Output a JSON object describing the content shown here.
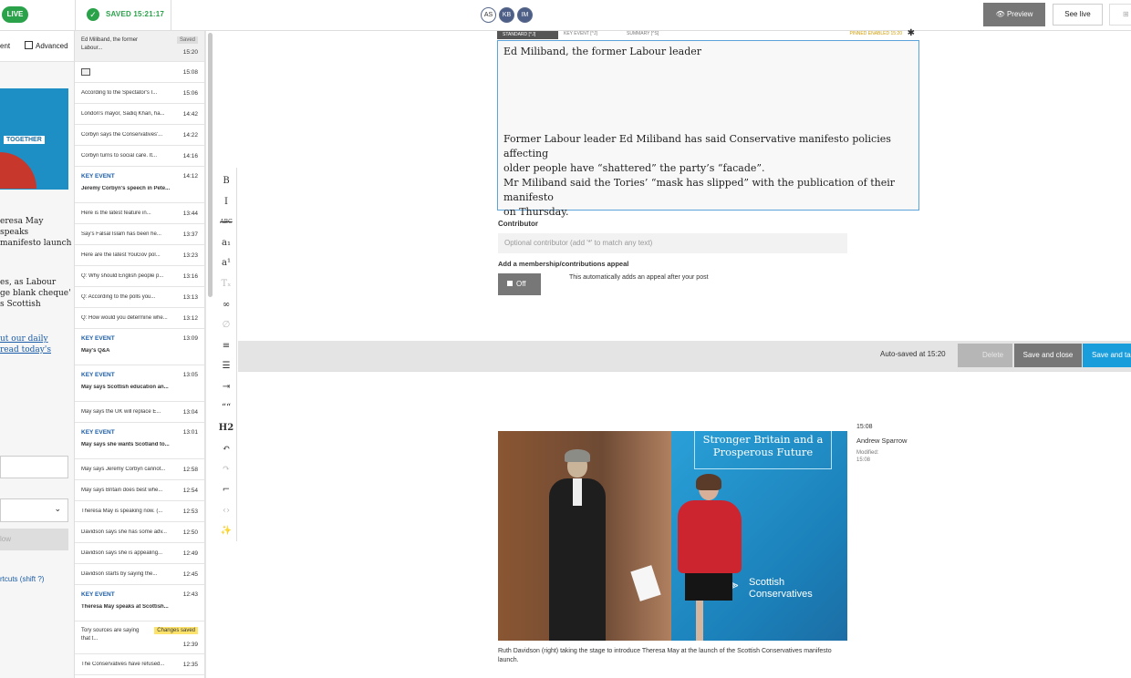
{
  "topbar": {
    "live_label": "LIVE",
    "saved_label": "SAVED 15:21:17",
    "avatars": [
      "AS",
      "KB",
      "IM"
    ],
    "preview_label": "Preview",
    "see_live_label": "See live"
  },
  "left_panel": {
    "tab_partial": "ent",
    "advanced_label": "Advanced",
    "thumb_text": "TOGETHER",
    "headline_lines": [
      "eresa May speaks",
      "manifesto launch"
    ],
    "para_lines": [
      "es, as Labour",
      "ge blank cheque'",
      "s Scottish"
    ],
    "link_lines": [
      "ut our daily",
      "read today's"
    ],
    "button_partial": "low",
    "shortcut_text": "rtcuts (shift ?)"
  },
  "feed": {
    "items": [
      {
        "text": "Ed Miliband, the former Labour...",
        "time": "15:20",
        "badge": "Saved",
        "h": 34
      },
      {
        "text": "",
        "time": "15:08",
        "image": true,
        "h": 23
      },
      {
        "text": "According to the Spectator's I...",
        "time": "15:06",
        "h": 23
      },
      {
        "text": "London's mayor, Sadiq Khan, ha...",
        "time": "14:42",
        "h": 23
      },
      {
        "text": "Corbyn says the Conservatives'...",
        "time": "14:22",
        "h": 23
      },
      {
        "text": "Corbyn turns to social care. It...",
        "time": "14:16",
        "h": 23
      },
      {
        "text": "Jeremy Corbyn's speech in Pete...",
        "time": "14:12",
        "key": true,
        "h": 40
      },
      {
        "text": "Here is the latest feature in...",
        "time": "13:44",
        "h": 23
      },
      {
        "text": "Say's Falsal Islam has been he...",
        "time": "13:37",
        "h": 23
      },
      {
        "text": "Here are the latest YouGov pol...",
        "time": "13:23",
        "h": 23
      },
      {
        "text": "Q: Why should English people p...",
        "time": "13:16",
        "h": 23
      },
      {
        "text": "Q: According to the polls you...",
        "time": "13:13",
        "h": 23
      },
      {
        "text": "Q: How would you determine whe...",
        "time": "13:12",
        "h": 23
      },
      {
        "text": "May's Q&A",
        "time": "13:09",
        "key": true,
        "h": 40
      },
      {
        "text": "May says Scottish education an...",
        "time": "13:05",
        "key": true,
        "h": 40
      },
      {
        "text": "May says the UK will replace E...",
        "time": "13:04",
        "h": 23
      },
      {
        "text": "May says she wants Scotland to...",
        "time": "13:01",
        "key": true,
        "h": 40
      },
      {
        "text": "May says Jeremy Corbyn cannot...",
        "time": "12:58",
        "h": 23
      },
      {
        "text": "May says Britain does best whe...",
        "time": "12:54",
        "h": 23
      },
      {
        "text": "Theresa May is speaking now. (...",
        "time": "12:53",
        "h": 23
      },
      {
        "text": "Davidson says she has some adv...",
        "time": "12:50",
        "h": 23
      },
      {
        "text": "Davidson says she is appealing...",
        "time": "12:49",
        "h": 23
      },
      {
        "text": "Davidson starts by saying the...",
        "time": "12:45",
        "h": 23
      },
      {
        "text": "Theresa May speaks at Scottish...",
        "time": "12:43",
        "key": true,
        "h": 40
      },
      {
        "text": "Tory sources are saying that t...",
        "time": "12:39",
        "badge2": "Changes saved",
        "h": 36
      },
      {
        "text": "The Conservatives have refused...",
        "time": "12:35",
        "h": 23
      }
    ],
    "key_event_label": "KEY EVENT"
  },
  "toolbar": {
    "icons": [
      "bold-icon",
      "italic-icon",
      "strikethrough-icon",
      "subscript-icon",
      "superscript-icon",
      "clear-format-icon",
      "link-icon",
      "unlink-icon",
      "bullet-list-icon",
      "numbered-list-icon",
      "indent-icon",
      "quote-icon",
      "heading-icon",
      "undo-icon",
      "redo-icon",
      "embed-icon",
      "code-icon",
      "magic-wand-icon"
    ],
    "glyphs": [
      "B",
      "I",
      "ABC",
      "a₁",
      "a¹",
      "Tₓ",
      "∞",
      "∅",
      "≡",
      "☰",
      "⇥",
      "““",
      "H2",
      "↶",
      "↷",
      "⌐",
      "‹›",
      "✨"
    ]
  },
  "editor": {
    "tabs": [
      "STANDARD [^J]",
      "KEY EVENT [^J]",
      "SUMMARY [^S]",
      "PINNED ENABLED 15:20"
    ],
    "heading": "Ed Miliband, the former Labour leader",
    "body_lines": [
      "Former Labour leader Ed Miliband has said Conservative manifesto policies affecting",
      "older people have “shattered” the party’s “facade”.",
      "Mr Miliband said the Tories’ “mask has slipped” with the publication of their manifesto",
      "on Thursday."
    ],
    "contributor_label": "Contributor",
    "contributor_placeholder": "Optional contributor (add '*' to match any text)",
    "appeal_label": "Add a membership/contributions appeal",
    "appeal_toggle": "Off",
    "appeal_help": "This automatically adds an appeal after your post"
  },
  "actionbar": {
    "autosaved": "Auto-saved at 15:20",
    "delete": "Delete",
    "save_close": "Save and close",
    "save": "Save and ta"
  },
  "post": {
    "sign_text": "Stronger Britain and a Prosperous Future",
    "logo_text_1": "Scottish",
    "logo_text_2": "Conservatives",
    "caption": "Ruth Davidson (right) taking the stage to introduce Theresa May at the launch of the Scottish Conservatives manifesto launch.",
    "time": "15:08",
    "author": "Andrew Sparrow",
    "modified_label": "Modified:",
    "modified_time": "15:08"
  },
  "colors": {
    "live_green": "#2aa24a",
    "link_blue": "#1a5ca8",
    "save_blue": "#1a9ddb",
    "editor_border": "#5ba3d8"
  }
}
